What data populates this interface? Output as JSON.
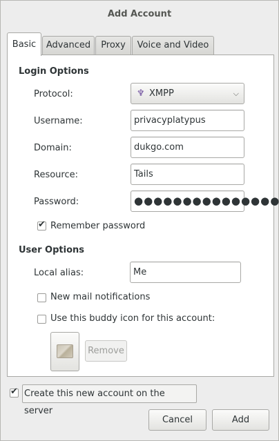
{
  "window": {
    "title": "Add Account"
  },
  "tabs": [
    {
      "label": "Basic",
      "active": true
    },
    {
      "label": "Advanced",
      "active": false
    },
    {
      "label": "Proxy",
      "active": false
    },
    {
      "label": "Voice and Video",
      "active": false
    }
  ],
  "login": {
    "section_title": "Login Options",
    "protocol_label": "Protocol:",
    "protocol_value": "XMPP",
    "protocol_icon": "xmpp-icon",
    "username_label": "Username:",
    "username_value": "privacyplatypus",
    "domain_label": "Domain:",
    "domain_value": "dukgo.com",
    "resource_label": "Resource:",
    "resource_value": "Tails",
    "password_label": "Password:",
    "password_masked": "●●●●●●●●●●●●●●●●",
    "remember_label": "Remember password",
    "remember_checked": true
  },
  "user": {
    "section_title": "User Options",
    "alias_label": "Local alias:",
    "alias_value": "Me",
    "mail_label": "New mail notifications",
    "mail_checked": false,
    "buddy_icon_label": "Use this buddy icon for this account:",
    "buddy_icon_checked": false,
    "remove_label": "Remove"
  },
  "footer": {
    "create_label": "Create this new account on the server",
    "create_checked": true,
    "cancel_label": "Cancel",
    "add_label": "Add"
  }
}
